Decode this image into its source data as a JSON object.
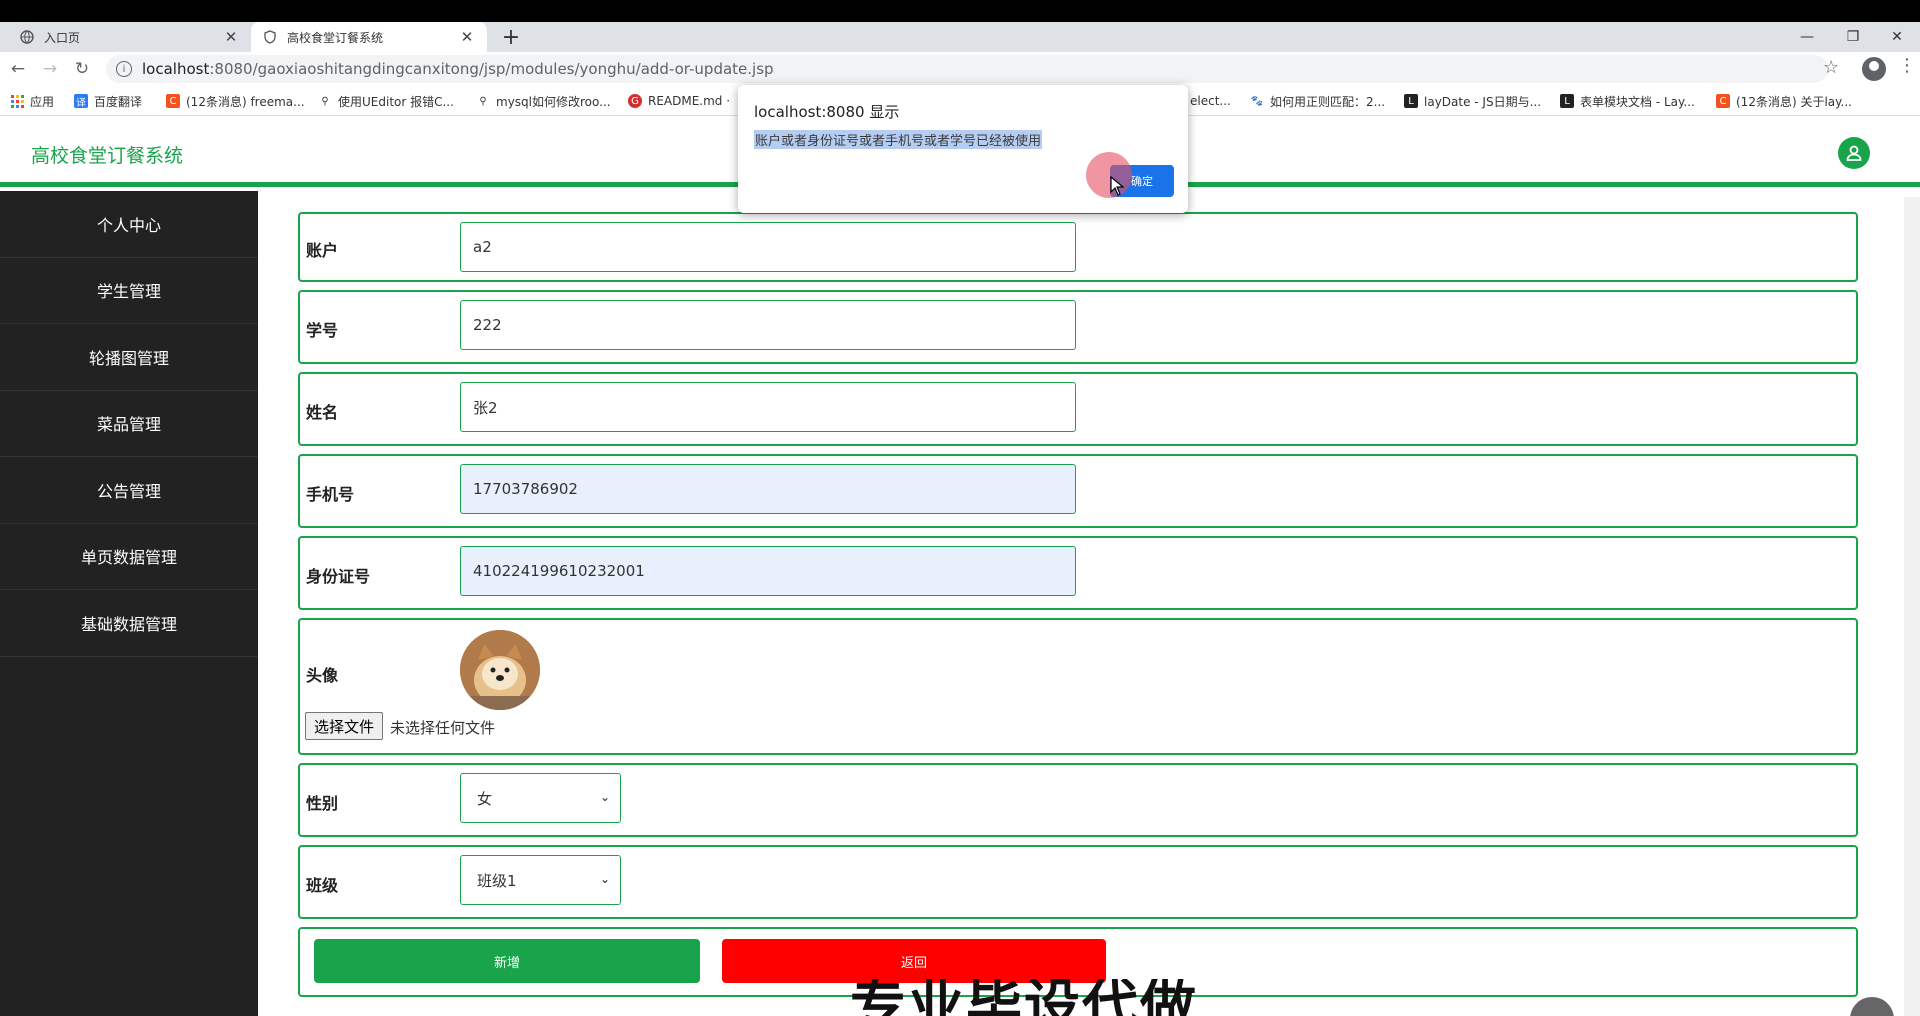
{
  "browser": {
    "tabs": [
      {
        "title": "入口页",
        "icon": "globe-icon",
        "active": false
      },
      {
        "title": "高校食堂订餐系统",
        "icon": "shield-icon",
        "active": true
      }
    ],
    "new_tab": "+",
    "url_host": "localhost",
    "url_path": ":8080/gaoxiaoshitangdingcanxitong/jsp/modules/yonghu/add-or-update.jsp",
    "bookmarks": [
      {
        "label": "应用",
        "color": "#4285f4"
      },
      {
        "label": "百度翻译",
        "color": "#2b7bf2"
      },
      {
        "label": "(12条消息) freema...",
        "color": "#f4511e"
      },
      {
        "label": "使用UEditor 报错C...",
        "color": "#333333"
      },
      {
        "label": "mysql如何修改roo...",
        "color": "#333333"
      },
      {
        "label": "README.md ·",
        "color": "#d32f2f"
      },
      {
        "label": "elect...",
        "color": "#888888"
      },
      {
        "label": "如何用正则匹配：2...",
        "color": "#3f51b5"
      },
      {
        "label": "layDate - JS日期与...",
        "color": "#222222"
      },
      {
        "label": "表单模块文档 - Lay...",
        "color": "#222222"
      },
      {
        "label": "(12条消息) 关于lay...",
        "color": "#f4511e"
      }
    ]
  },
  "app": {
    "brand": "高校食堂订餐系统",
    "primary_color": "#19a44b",
    "sidebar": [
      "个人中心",
      "学生管理",
      "轮播图管理",
      "菜品管理",
      "公告管理",
      "单页数据管理",
      "基础数据管理"
    ]
  },
  "form": {
    "account_label": "账户",
    "account_value": "a2",
    "student_id_label": "学号",
    "student_id_value": "222",
    "name_label": "姓名",
    "name_value": "张2",
    "phone_label": "手机号",
    "phone_value": "17703786902",
    "id_card_label": "身份证号",
    "id_card_value": "410224199610232001",
    "avatar_label": "头像",
    "file_button": "选择文件",
    "file_status": "未选择任何文件",
    "gender_label": "性别",
    "gender_value": "女",
    "class_label": "班级",
    "class_value": "班级1",
    "add_button": "新增",
    "back_button": "返回"
  },
  "dialog": {
    "title": "localhost:8080 显示",
    "message": "账户或者身份证号或者手机号或者学号已经被使用",
    "ok_button": "确定"
  },
  "overlay": {
    "watermark": "专业毕设代做"
  }
}
